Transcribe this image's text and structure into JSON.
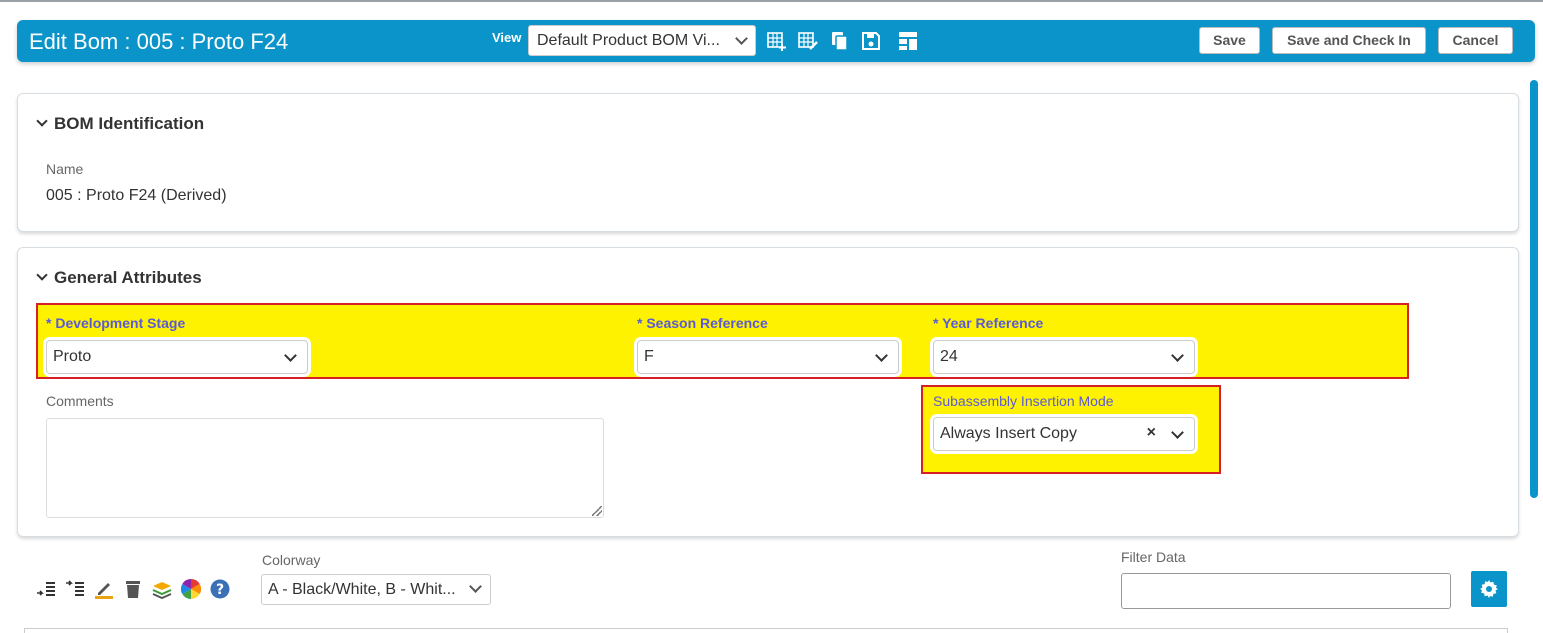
{
  "header": {
    "title": "Edit Bom : 005 : Proto F24",
    "view_label": "View",
    "view_value": "Default Product BOM Vi...",
    "save_label": "Save",
    "save_checkin_label": "Save and Check In",
    "cancel_label": "Cancel",
    "accent_color": "#0a94c9"
  },
  "bom_identification": {
    "section_title": "BOM Identification",
    "name_label": "Name",
    "name_value": "005 : Proto F24  (Derived)"
  },
  "general_attributes": {
    "section_title": "General Attributes",
    "development_stage": {
      "label": "* Development Stage",
      "value": "Proto"
    },
    "season_reference": {
      "label": "* Season Reference",
      "value": "F"
    },
    "year_reference": {
      "label": "* Year Reference",
      "value": "24"
    },
    "comments_label": "Comments",
    "comments_value": "",
    "subassembly_mode": {
      "label": "Subassembly Insertion Mode",
      "value": "Always Insert Copy",
      "clear": "×"
    }
  },
  "toolbar": {
    "colorway_label": "Colorway",
    "colorway_value": "A - Black/White, B - Whit...",
    "filter_label": "Filter Data",
    "filter_value": "",
    "icons": [
      "insert-above-icon",
      "insert-below-icon",
      "edit-icon",
      "delete-icon",
      "layers-icon",
      "color-wheel-icon",
      "help-icon",
      "gear-icon"
    ]
  }
}
